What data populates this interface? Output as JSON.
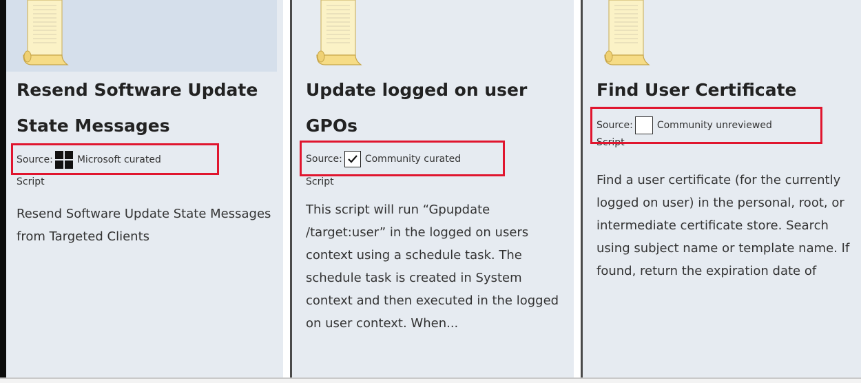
{
  "cards": [
    {
      "title": "Resend Software Update State Messages",
      "source_label": "Source:",
      "source_icon": "microsoft-logo-icon",
      "source_text": "Microsoft curated",
      "type": "Script",
      "description": "Resend Software Update State Messages from Targeted Clients"
    },
    {
      "title": "Update logged on user GPOs",
      "source_label": "Source:",
      "source_icon": "checkmark-box-icon",
      "source_text": "Community curated",
      "type": "Script",
      "description": "This script will run “Gpupdate /target:user” in the logged on users context using a schedule task. The schedule task is created in System context and then executed in the logged on user context. When..."
    },
    {
      "title": "Find User Certificate",
      "source_label": "Source:",
      "source_icon": "empty-box-icon",
      "source_text": "Community unreviewed",
      "type": "Script",
      "description": "Find a user certificate (for the currently logged on user) in the personal, root, or intermediate certificate store. Search using subject name or template name. If found, return the expiration date of"
    }
  ],
  "colors": {
    "card_bg": "#e6ebf1",
    "highlight_box": "#e0152e",
    "thumbnail_bg": "#d5dfeb"
  }
}
